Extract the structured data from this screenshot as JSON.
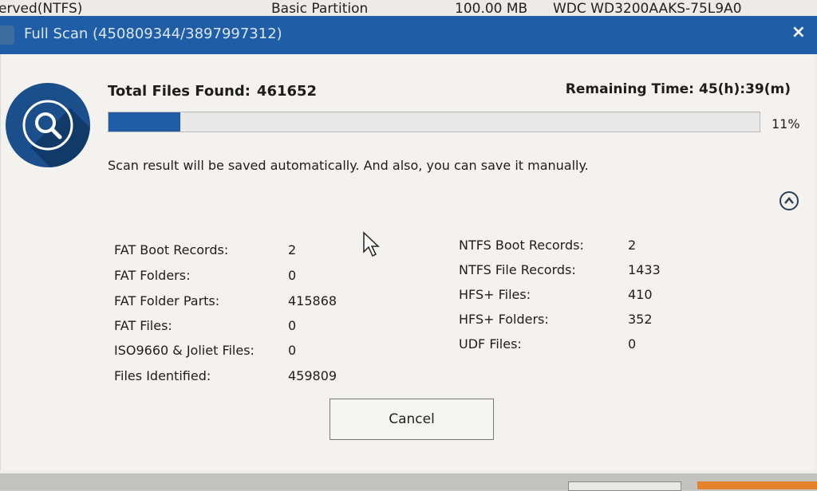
{
  "background_row": {
    "col1": "erved(NTFS)",
    "col2": "Basic Partition",
    "col3": "100.00 MB",
    "col4": "WDC WD3200AAKS-75L9A0"
  },
  "dialog": {
    "title": "Full Scan (450809344/3897997312)",
    "close_symbol": "×"
  },
  "scan": {
    "total_label": "Total Files Found:",
    "total_value": "461652",
    "remaining_label": "Remaining Time:",
    "remaining_value": "45(h):39(m)",
    "progress_percent": 11,
    "progress_text": "11%",
    "message": "Scan result will be saved automatically.  And also, you can save it manually."
  },
  "stats_left": [
    {
      "label": "FAT Boot Records:",
      "value": "2"
    },
    {
      "label": "FAT Folders:",
      "value": "0"
    },
    {
      "label": "FAT Folder Parts:",
      "value": "415868"
    },
    {
      "label": "FAT Files:",
      "value": "0"
    },
    {
      "label": "ISO9660 & Joliet Files:",
      "value": "0"
    },
    {
      "label": "Files Identified:",
      "value": "459809"
    }
  ],
  "stats_right": [
    {
      "label": "NTFS Boot Records:",
      "value": "2"
    },
    {
      "label": "NTFS File Records:",
      "value": "1433"
    },
    {
      "label": "HFS+ Files:",
      "value": "410"
    },
    {
      "label": "HFS+ Folders:",
      "value": "352"
    },
    {
      "label": "UDF Files:",
      "value": "0"
    }
  ],
  "buttons": {
    "cancel_label": "Cancel"
  },
  "icons": {
    "badge": "magnifier-icon",
    "collapse": "chevron-up-icon",
    "close": "close-icon",
    "cursor": "mouse-pointer-icon"
  },
  "colors": {
    "titlebar": "#1f5ea6",
    "progress_fill": "#1f5ea6",
    "badge": "#1a4f8c"
  }
}
